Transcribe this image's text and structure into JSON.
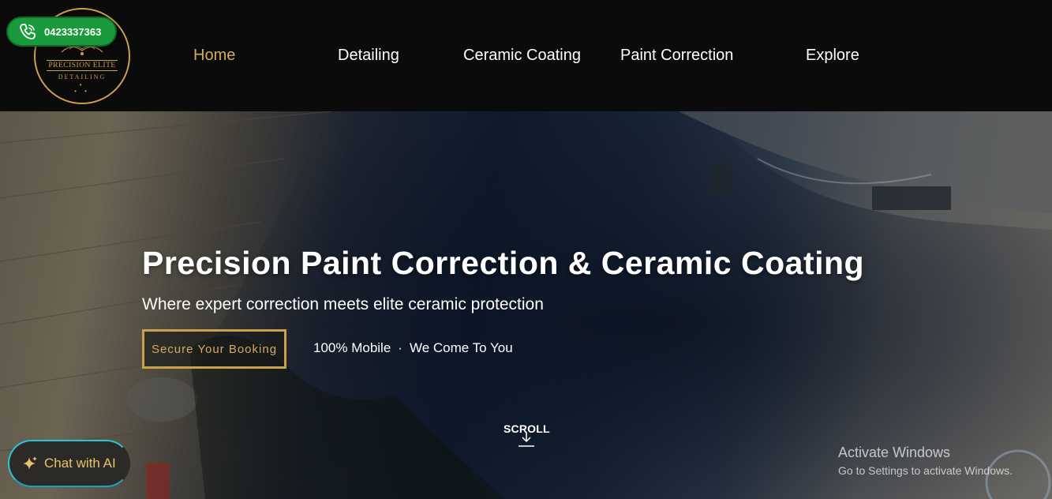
{
  "header": {
    "logo": {
      "line1": "PRECISION ELITE",
      "line2": "DETAILING",
      "icon": "crest-logo-icon"
    },
    "phone": {
      "number": "0423337363",
      "icon": "phone-icon",
      "color": "#1a9a3c"
    }
  },
  "nav": {
    "items": [
      {
        "label": "Home",
        "active": true
      },
      {
        "label": "Detailing",
        "active": false
      },
      {
        "label": "Ceramic Coating",
        "active": false
      },
      {
        "label": "Paint Correction",
        "active": false
      },
      {
        "label": "Explore",
        "active": false
      }
    ],
    "active_color": "#d3aa5e"
  },
  "hero": {
    "title": "Precision Paint Correction & Ceramic Coating",
    "subtitle": "Where expert correction meets elite ceramic protection",
    "cta_label": "Secure Your Booking",
    "mobile_note": {
      "part1": "100% Mobile",
      "separator": "·",
      "part2": "We Come To You"
    },
    "scroll_label": "SCROLL",
    "scroll_icon": "arrow-down-icon"
  },
  "chat": {
    "label": "Chat with AI",
    "icon": "sparkle-icon"
  },
  "os_overlay": {
    "title": "Activate Windows",
    "subtitle": "Go to Settings to activate Windows."
  },
  "colors": {
    "gold": "#c9a04c",
    "header_bg": "#0b0b0b",
    "chat_border": "#2bc3d8"
  }
}
